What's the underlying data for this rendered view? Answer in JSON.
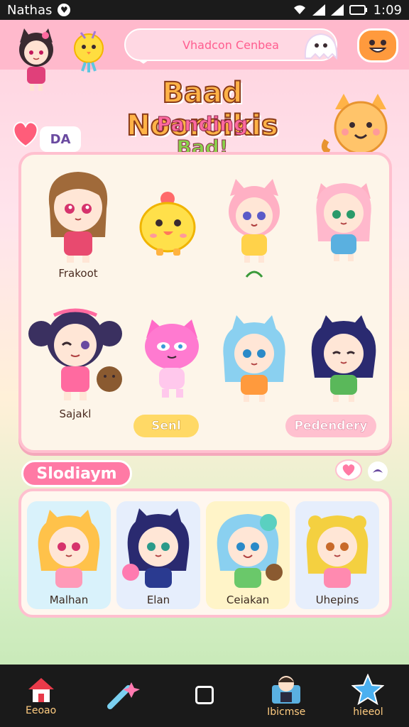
{
  "status_bar": {
    "app_name": "Nathas",
    "time": "1:09"
  },
  "header": {
    "search_label": "Vhadcon Cenbea"
  },
  "title": {
    "main": "Baad Nooroikis",
    "sub_part1": "Panding ",
    "sub_part2": "Bad!",
    "badge": "DA"
  },
  "characters": [
    {
      "label": "Frakoot"
    },
    {
      "label": ""
    },
    {
      "label": ""
    },
    {
      "label": ""
    },
    {
      "label": "Sajakl"
    },
    {
      "label": ""
    },
    {
      "label": ""
    },
    {
      "label": ""
    }
  ],
  "buttons": {
    "seni": "Senl",
    "pedendery": "Pedendery"
  },
  "section": {
    "title": "Slodiaym",
    "cards": [
      {
        "label": "Malhan"
      },
      {
        "label": "Elan"
      },
      {
        "label": "Ceiakan"
      },
      {
        "label": "Uhepins"
      }
    ]
  },
  "nav": [
    {
      "label": "Eeoao",
      "icon": "home-icon"
    },
    {
      "label": "",
      "icon": "wand-icon"
    },
    {
      "label": "",
      "icon": "square-icon"
    },
    {
      "label": "Ibicmse",
      "icon": "profile-icon"
    },
    {
      "label": "hieeol",
      "icon": "star-icon"
    }
  ],
  "colors": {
    "accent_pink": "#ff7aa5",
    "panel_border": "#ffc0cf",
    "title_orange": "#ffb347",
    "nav_bg": "#1a1a1a"
  }
}
